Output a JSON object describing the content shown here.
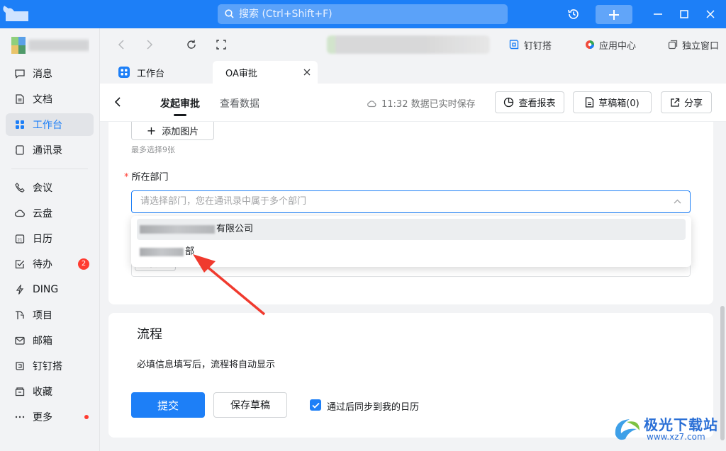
{
  "titlebar": {
    "search_placeholder": "搜索 (Ctrl+Shift+F)",
    "accent": "#1d7ff7"
  },
  "sidebar": {
    "items": [
      {
        "label": "消息",
        "icon": "message-icon"
      },
      {
        "label": "文档",
        "icon": "document-icon"
      },
      {
        "label": "工作台",
        "icon": "grid-icon",
        "active": true
      },
      {
        "label": "通讯录",
        "icon": "contacts-icon"
      },
      {
        "label": "会议",
        "icon": "phone-icon"
      },
      {
        "label": "云盘",
        "icon": "cloud-icon"
      },
      {
        "label": "日历",
        "icon": "calendar-icon"
      },
      {
        "label": "待办",
        "icon": "todo-icon",
        "badge": "2"
      },
      {
        "label": "DING",
        "icon": "lightning-icon"
      },
      {
        "label": "项目",
        "icon": "project-icon"
      },
      {
        "label": "邮箱",
        "icon": "mail-icon"
      },
      {
        "label": "钉钉搭",
        "icon": "dingda-icon"
      },
      {
        "label": "收藏",
        "icon": "favorites-icon"
      },
      {
        "label": "更多",
        "icon": "more-icon",
        "dot": true
      }
    ]
  },
  "toolbar": {
    "link_dingda": "钉钉搭",
    "link_appcenter": "应用中心",
    "link_window": "独立窗口"
  },
  "tabs": [
    {
      "label": "工作台"
    },
    {
      "label": "OA审批",
      "active": true
    }
  ],
  "subheader": {
    "tab_start": "发起审批",
    "tab_data": "查看数据",
    "saved_status": "11:32 数据已实时保存",
    "btn_report": "查看报表",
    "btn_drafts": "草稿箱(0)",
    "btn_share": "分享"
  },
  "form": {
    "add_image": "添加图片",
    "image_hint": "最多选择9张",
    "dept_label": "所在部门",
    "dept_placeholder": "请选择部门，您在通讯录中属于多个部门",
    "options": [
      {
        "visible_text": "有限公司"
      },
      {
        "visible_text": "部"
      }
    ],
    "under_add": "添加"
  },
  "flow": {
    "title": "流程",
    "text": "必填信息填写后，流程将自动显示",
    "submit": "提交",
    "save_draft": "保存草稿",
    "sync_calendar": "通过后同步到我的日历",
    "sync_checked": true
  },
  "watermark": {
    "line1": "极光下载站",
    "line2": "www.xz7.com"
  },
  "annotation": {
    "arrow_color": "#f03a2e"
  }
}
